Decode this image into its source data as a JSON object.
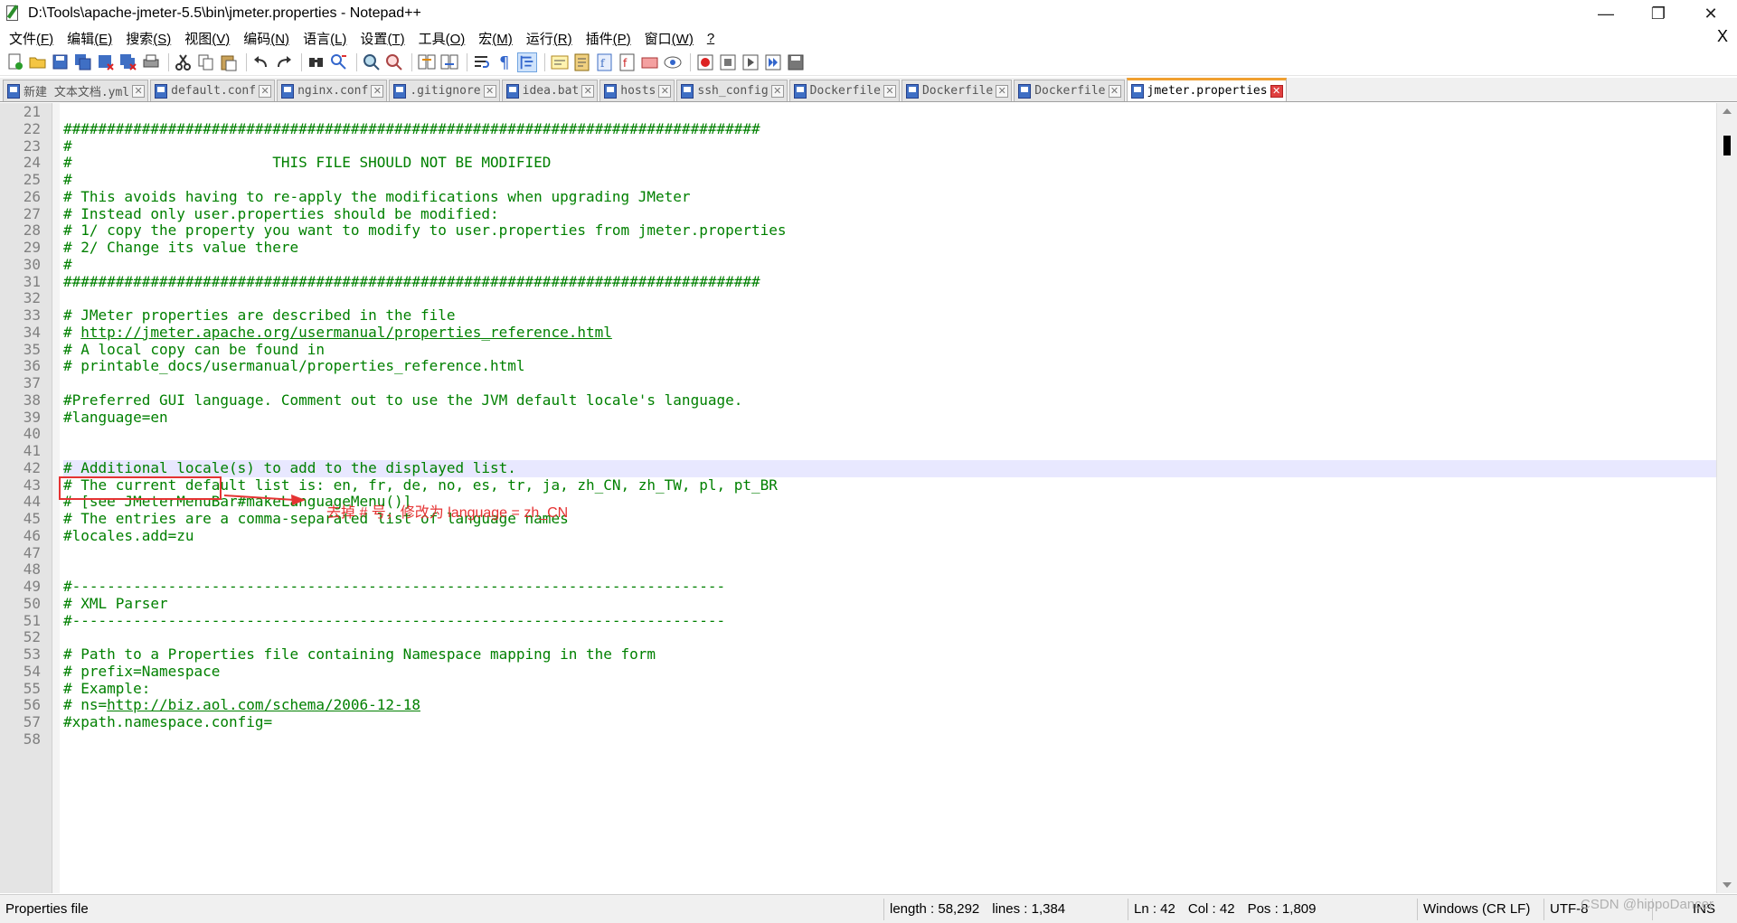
{
  "window": {
    "title": "D:\\Tools\\apache-jmeter-5.5\\bin\\jmeter.properties - Notepad++",
    "minimize_glyph": "—",
    "maximize_glyph": "❐",
    "close_glyph": "✕"
  },
  "menubar": {
    "items": [
      {
        "label": "文件",
        "key": "(F)"
      },
      {
        "label": "编辑",
        "key": "(E)"
      },
      {
        "label": "搜索",
        "key": "(S)"
      },
      {
        "label": "视图",
        "key": "(V)"
      },
      {
        "label": "编码",
        "key": "(N)"
      },
      {
        "label": "语言",
        "key": "(L)"
      },
      {
        "label": "设置",
        "key": "(T)"
      },
      {
        "label": "工具",
        "key": "(O)"
      },
      {
        "label": "宏",
        "key": "(M)"
      },
      {
        "label": "运行",
        "key": "(R)"
      },
      {
        "label": "插件",
        "key": "(P)"
      },
      {
        "label": "窗口",
        "key": "(W)"
      },
      {
        "label": "",
        "key": "?"
      }
    ],
    "close_glyph": "X"
  },
  "toolbar": {
    "icons": [
      "new-file-icon",
      "open-file-icon",
      "save-icon",
      "save-all-icon",
      "close-icon",
      "close-all-icon",
      "print-icon",
      "cut-icon",
      "copy-icon",
      "paste-icon",
      "undo-icon",
      "redo-icon",
      "find-icon",
      "replace-icon",
      "zoom-in-icon",
      "zoom-out-icon",
      "sync-vertical-icon",
      "sync-horizontal-icon",
      "word-wrap-icon",
      "show-all-characters-icon",
      "indent-guide-icon",
      "user-language-icon",
      "doc-map-icon",
      "function-list-icon",
      "folder-workspace-icon",
      "document-list-icon",
      "monitoring-icon",
      "record-macro-icon",
      "stop-record-icon",
      "play-macro-icon",
      "run-macro-multiple-icon",
      "save-macro-icon"
    ]
  },
  "tabs": [
    {
      "label": "新建 文本文档.yml",
      "active": false
    },
    {
      "label": "default.conf",
      "active": false
    },
    {
      "label": "nginx.conf",
      "active": false
    },
    {
      "label": ".gitignore",
      "active": false
    },
    {
      "label": "idea.bat",
      "active": false
    },
    {
      "label": "hosts",
      "active": false
    },
    {
      "label": "ssh_config",
      "active": false
    },
    {
      "label": "Dockerfile",
      "active": false
    },
    {
      "label": "Dockerfile",
      "active": false
    },
    {
      "label": "Dockerfile",
      "active": false
    },
    {
      "label": "jmeter.properties",
      "active": true
    }
  ],
  "tab_close_glyph": "✕",
  "editor": {
    "current_line": 42,
    "lines": [
      {
        "n": "21",
        "text": ""
      },
      {
        "n": "22",
        "text": "################################################################################"
      },
      {
        "n": "23",
        "text": "#"
      },
      {
        "n": "24",
        "text": "#                       THIS FILE SHOULD NOT BE MODIFIED"
      },
      {
        "n": "25",
        "text": "#"
      },
      {
        "n": "26",
        "text": "# This avoids having to re-apply the modifications when upgrading JMeter"
      },
      {
        "n": "27",
        "text": "# Instead only user.properties should be modified:"
      },
      {
        "n": "28",
        "text": "# 1/ copy the property you want to modify to user.properties from jmeter.properties"
      },
      {
        "n": "29",
        "text": "# 2/ Change its value there"
      },
      {
        "n": "30",
        "text": "#"
      },
      {
        "n": "31",
        "text": "################################################################################"
      },
      {
        "n": "32",
        "text": ""
      },
      {
        "n": "33",
        "text": "# JMeter properties are described in the file"
      },
      {
        "n": "34",
        "text": "# ",
        "link": "http://jmeter.apache.org/usermanual/properties_reference.html"
      },
      {
        "n": "35",
        "text": "# A local copy can be found in"
      },
      {
        "n": "36",
        "text": "# printable_docs/usermanual/properties_reference.html"
      },
      {
        "n": "37",
        "text": ""
      },
      {
        "n": "38",
        "text": "#Preferred GUI language. Comment out to use the JVM default locale's language."
      },
      {
        "n": "39",
        "text": "#language=en"
      },
      {
        "n": "40",
        "text": ""
      },
      {
        "n": "41",
        "text": ""
      },
      {
        "n": "42",
        "text": "# Additional locale(s) to add to the displayed list."
      },
      {
        "n": "43",
        "text": "# The current default list is: en, fr, de, no, es, tr, ja, zh_CN, zh_TW, pl, pt_BR"
      },
      {
        "n": "44",
        "text": "# [see JMeterMenuBar#makeLanguageMenu()]"
      },
      {
        "n": "45",
        "text": "# The entries are a comma-separated list of language names"
      },
      {
        "n": "46",
        "text": "#locales.add=zu"
      },
      {
        "n": "47",
        "text": ""
      },
      {
        "n": "48",
        "text": ""
      },
      {
        "n": "49",
        "text": "#---------------------------------------------------------------------------"
      },
      {
        "n": "50",
        "text": "# XML Parser"
      },
      {
        "n": "51",
        "text": "#---------------------------------------------------------------------------"
      },
      {
        "n": "52",
        "text": ""
      },
      {
        "n": "53",
        "text": "# Path to a Properties file containing Namespace mapping in the form"
      },
      {
        "n": "54",
        "text": "# prefix=Namespace"
      },
      {
        "n": "55",
        "text": "# Example:"
      },
      {
        "n": "56",
        "text": "# ns=",
        "link": "http://biz.aol.com/schema/2006-12-18"
      },
      {
        "n": "57",
        "text": "#xpath.namespace.config="
      },
      {
        "n": "58",
        "text": ""
      }
    ]
  },
  "annotation": {
    "text": "去掉 # 号，修改为 language = zh_CN",
    "color": "#e53333"
  },
  "statusbar": {
    "file_type": "Properties file",
    "length": "length : 58,292",
    "lines": "lines : 1,384",
    "ln": "Ln : 42",
    "col": "Col : 42",
    "pos": "Pos : 1,809",
    "eol": "Windows (CR LF)",
    "encoding": "UTF-8",
    "mode": "INS"
  },
  "watermark": "CSDN @hippoDancer",
  "colors": {
    "comment_green": "#008000",
    "current_line_bg": "#e8e8ff",
    "gutter_bg": "#e4e4e4",
    "active_tab_accent": "#f0a030"
  }
}
